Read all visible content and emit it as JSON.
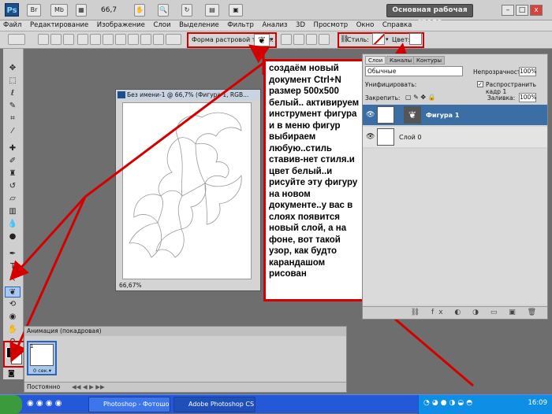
{
  "titlebar": {
    "app_logo": "Ps",
    "mb_label": "Mb",
    "zoom": "66,7",
    "workspace": "Основная рабочая среда",
    "win_min": "–",
    "win_max": "□",
    "win_close": "x"
  },
  "menubar": {
    "items": [
      "Файл",
      "Редактирование",
      "Изображение",
      "Слои",
      "Выделение",
      "Фильтр",
      "Анализ",
      "3D",
      "Просмотр",
      "Окно",
      "Справка"
    ]
  },
  "options": {
    "shape_label": "Форма растровой точки:",
    "shape_glyph": "❦",
    "style_label": "Стиль:",
    "color_label": "Цвет:",
    "color_value": "#ffffff"
  },
  "toolbox": {
    "tools": [
      "move-tool-icon",
      "marquee-tool-icon",
      "lasso-tool-icon",
      "quick-select-tool-icon",
      "crop-tool-icon",
      "eyedropper-tool-icon",
      "healing-tool-icon",
      "brush-tool-icon",
      "clone-stamp-tool-icon",
      "history-brush-tool-icon",
      "eraser-tool-icon",
      "gradient-tool-icon",
      "blur-tool-icon",
      "dodge-tool-icon",
      "pen-tool-icon",
      "type-tool-icon",
      "path-select-tool-icon",
      "custom-shape-tool-icon",
      "3d-rotate-tool-icon",
      "3d-orbit-tool-icon",
      "hand-tool-icon",
      "zoom-tool-icon"
    ]
  },
  "document": {
    "title": "Без имени-1 @ 66,7% (Фигура 1, RGB...",
    "zoom": "66,67%"
  },
  "callout": {
    "text": "создаём новый документ Ctrl+N размер 500х500 белый.. активируем инструмент фигура и в меню фигур выбираем любую..стиль ставив-нет стиля.и цвет белый..и рисуйте эту фигуру на новом документе..у вас в слоях появится новый слой, а на фоне,  вот такой узор, как будто карандашом рисован"
  },
  "layers": {
    "tabs": [
      "Слои",
      "Каналы",
      "Контуры"
    ],
    "blend_mode": "Обычные",
    "opacity_label": "Непрозрачность:",
    "opacity_value": "100%",
    "unify_label": "Унифицировать:",
    "propagate_label": "Распространить кадр 1",
    "lock_label": "Закрепить:",
    "fill_label": "Заливка:",
    "fill_value": "100%",
    "rows": [
      {
        "name": "Фигура 1",
        "selected": true
      },
      {
        "name": "Слой 0",
        "selected": false
      }
    ],
    "footer_icons": "⛓ fx ◐ ◑ ▭ ▣ 🗑"
  },
  "animation": {
    "title": "Анимация (покадровая)",
    "frame_number": "1",
    "frame_time": "0 сек.▾",
    "loop": "Постоянно",
    "controls": "◀◀ ◀ ▶ ▶▶"
  },
  "taskbar": {
    "tasks": [
      "Photoshop - Фотошо...",
      "Adobe Photoshop CS..."
    ],
    "clock": "16:09"
  },
  "colors": {
    "accent_red": "#d40000",
    "selected_layer": "#3a6ea5",
    "taskbar": "#2458d6"
  }
}
